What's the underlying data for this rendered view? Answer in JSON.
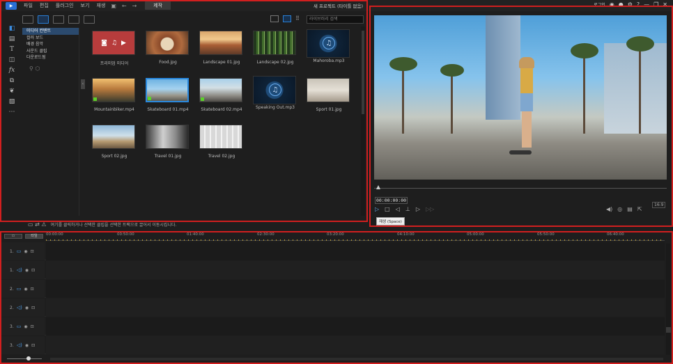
{
  "menubar": {
    "items": [
      "파일",
      "편집",
      "플러그인",
      "보기",
      "재생"
    ],
    "produce_label": "제작",
    "project_title": "새 프로젝트 (타이틀 없음)",
    "window_controls": [
      "로그인",
      "?",
      "—",
      "❐",
      "✕"
    ]
  },
  "library": {
    "tree": [
      "미디어 컨텐트",
      "컬러 보드",
      "배경 음악",
      "사운드 클립",
      "다운로드됨"
    ],
    "search_placeholder": "라이브러리 검색",
    "media": [
      {
        "label": "프리미엄 미디어",
        "kind": "premium"
      },
      {
        "label": "Food.jpg",
        "kind": "food"
      },
      {
        "label": "Landscape 01.jpg",
        "kind": "landscape1"
      },
      {
        "label": "Landscape 02.jpg",
        "kind": "landscape2"
      },
      {
        "label": "Mahoroba.mp3",
        "kind": "audio"
      },
      {
        "label": "Mountainbiker.mp4",
        "kind": "bike"
      },
      {
        "label": "Skateboard 01.mp4",
        "kind": "skate1"
      },
      {
        "label": "Skateboard 02.mp4",
        "kind": "skate2"
      },
      {
        "label": "Speaking Out.mp3",
        "kind": "audio"
      },
      {
        "label": "Sport 01.jpg",
        "kind": "sport1"
      },
      {
        "label": "Sport 02.jpg",
        "kind": "sport2"
      },
      {
        "label": "Travel 01.jpg",
        "kind": "travel1"
      },
      {
        "label": "Travel 02.jpg",
        "kind": "travel2"
      }
    ]
  },
  "preview": {
    "timecode": "00:00:00:00",
    "tooltip": "재생 (Space)",
    "aspect": "16:9"
  },
  "hint": "여기를 클릭하거나 선택한 클립을 선택한 트랙으로 끌어서 이동시킵니다.",
  "timeline": {
    "view_buttons": [
      "",
      "타임"
    ],
    "ruler": [
      "00:00:00",
      "00:50:00",
      "01:40:00",
      "02:30:00",
      "03:20:00",
      "04:10:00",
      "05:00:00",
      "05:50:00",
      "06:40:00"
    ],
    "tracks": [
      {
        "label": "1.",
        "type": "video"
      },
      {
        "label": "1.",
        "type": "audio"
      },
      {
        "label": "2.",
        "type": "video"
      },
      {
        "label": "2.",
        "type": "audio"
      },
      {
        "label": "3.",
        "type": "video"
      },
      {
        "label": "3.",
        "type": "audio"
      }
    ]
  },
  "colors": {
    "accent": "#2a8ae0",
    "outline": "#d21f1f"
  }
}
